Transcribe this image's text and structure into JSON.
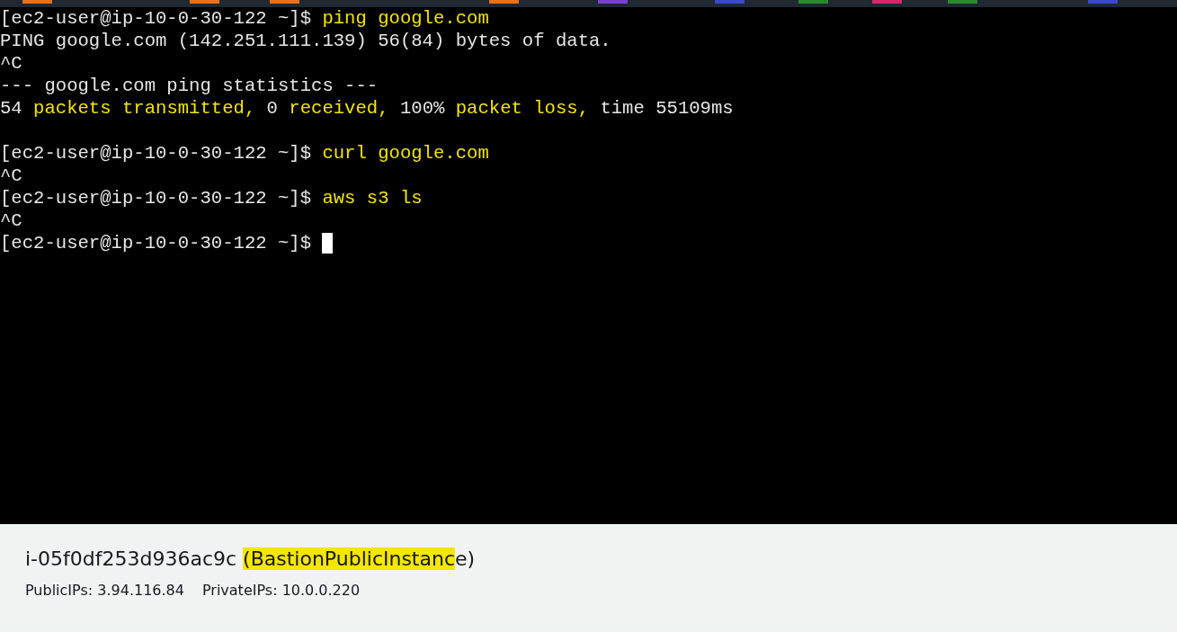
{
  "tab_markers": [
    {
      "color": "#e8711a"
    },
    {
      "color": "#e8711a"
    },
    {
      "color": "#e8711a"
    },
    {
      "color": "#e8711a"
    },
    {
      "color": "#7b3fd0"
    },
    {
      "color": "#3b48cc"
    },
    {
      "color": "#2a8a2a"
    },
    {
      "color": "#d6246e"
    },
    {
      "color": "#2a8a2a"
    },
    {
      "color": "#3b48cc"
    }
  ],
  "terminal": {
    "lines": [
      {
        "segments": [
          {
            "text": "[ec2-user@ip-10-0-30-122 ~]$ ",
            "kind": "plain"
          },
          {
            "text": "ping google.com",
            "kind": "highlight"
          }
        ]
      },
      {
        "segments": [
          {
            "text": "PING google.com (142.251.111.139) 56(84) bytes of data.",
            "kind": "plain"
          }
        ]
      },
      {
        "segments": [
          {
            "text": "^C",
            "kind": "plain"
          }
        ]
      },
      {
        "segments": [
          {
            "text": "--- google.com ping statistics ---",
            "kind": "plain"
          }
        ]
      },
      {
        "segments": [
          {
            "text": "54 ",
            "kind": "plain"
          },
          {
            "text": "packets transmitted, ",
            "kind": "highlight"
          },
          {
            "text": "0 ",
            "kind": "plain"
          },
          {
            "text": "received, ",
            "kind": "highlight"
          },
          {
            "text": "100% ",
            "kind": "plain"
          },
          {
            "text": "packet loss, ",
            "kind": "highlight"
          },
          {
            "text": "time 55109ms",
            "kind": "plain"
          }
        ]
      },
      {
        "blank": true
      },
      {
        "segments": [
          {
            "text": "[ec2-user@ip-10-0-30-122 ~]$ ",
            "kind": "plain"
          },
          {
            "text": "curl google.com",
            "kind": "highlight"
          }
        ]
      },
      {
        "segments": [
          {
            "text": "^C",
            "kind": "plain"
          }
        ]
      },
      {
        "segments": [
          {
            "text": "[ec2-user@ip-10-0-30-122 ~]$ ",
            "kind": "plain"
          },
          {
            "text": "aws s3 ls",
            "kind": "highlight"
          }
        ]
      },
      {
        "segments": [
          {
            "text": "^C",
            "kind": "plain"
          }
        ]
      },
      {
        "segments": [
          {
            "text": "[ec2-user@ip-10-0-30-122 ~]$ ",
            "kind": "plain"
          }
        ],
        "cursor": true
      }
    ]
  },
  "instance": {
    "title": [
      {
        "text": "i-05f0df253d936ac9c ",
        "highlighted": false
      },
      {
        "text": "(BastionPublicInstanc",
        "highlighted": true
      },
      {
        "text": "e)",
        "highlighted": false
      }
    ],
    "public_ips": "PublicIPs: 3.94.116.84",
    "private_ips": "PrivateIPs: 10.0.0.220"
  }
}
